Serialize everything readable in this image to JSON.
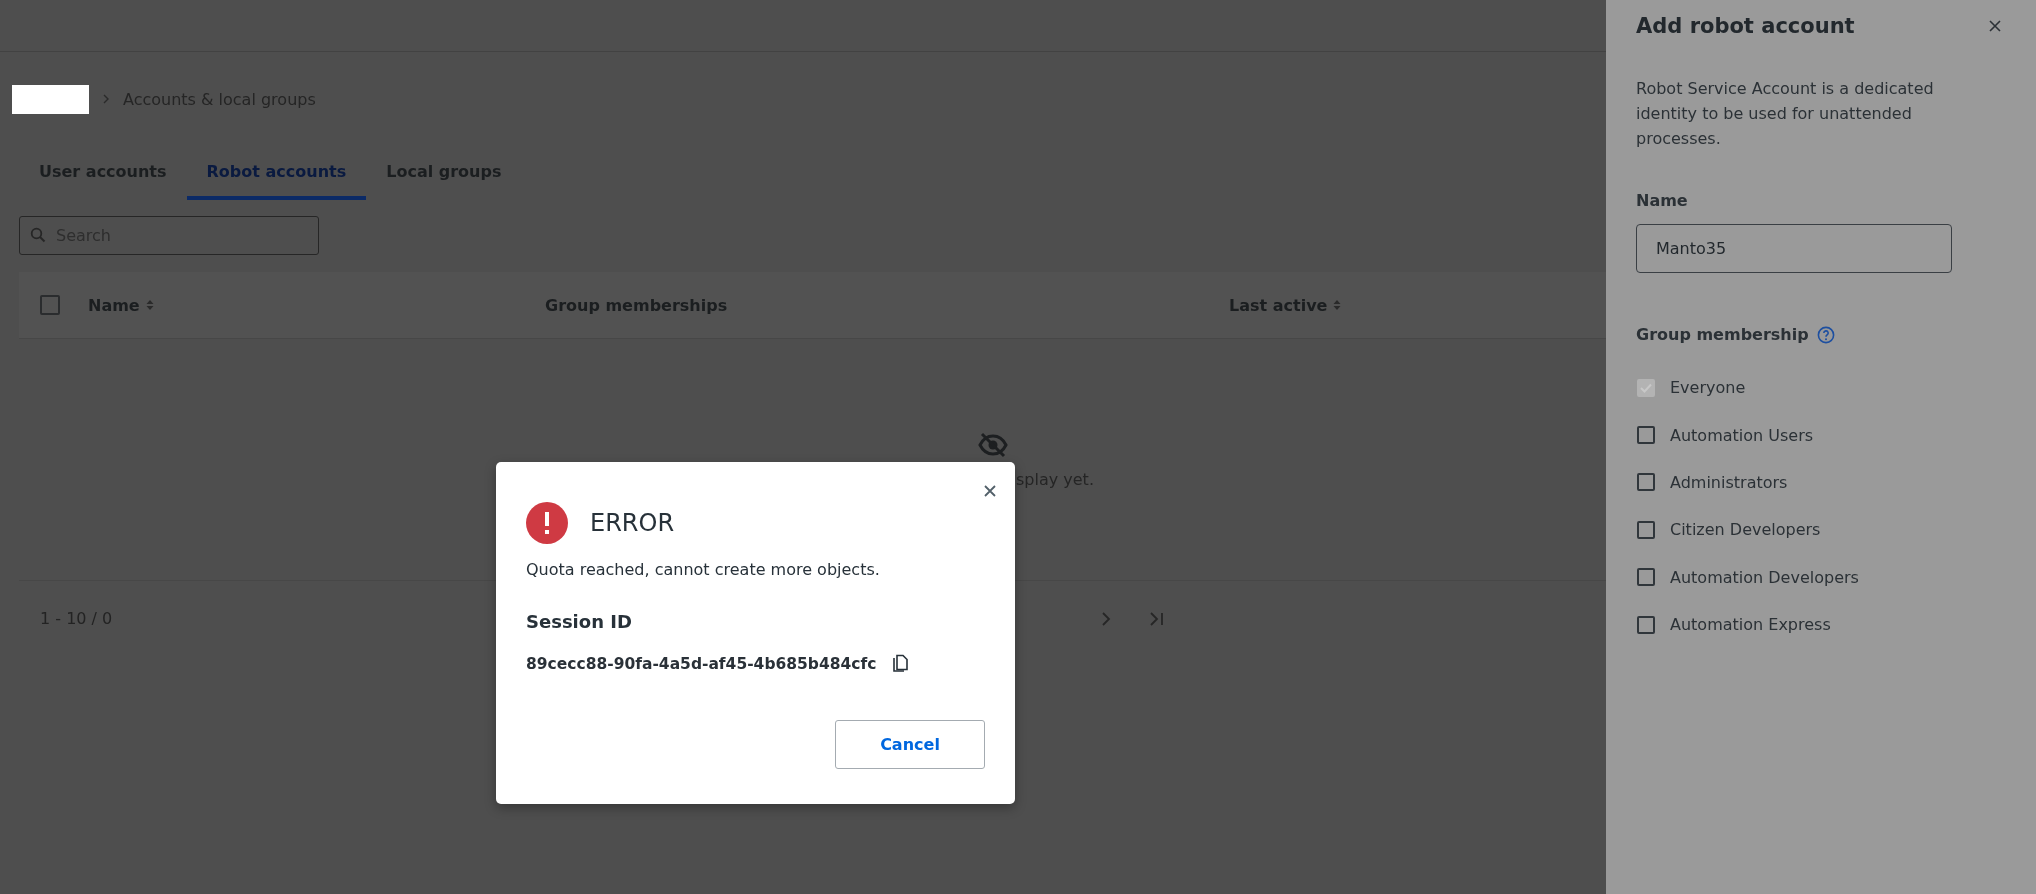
{
  "breadcrumb": {
    "items": [
      {
        "label": "Accounts & local groups"
      }
    ]
  },
  "tabs": [
    {
      "label": "User accounts",
      "selected": false
    },
    {
      "label": "Robot accounts",
      "selected": true
    },
    {
      "label": "Local groups",
      "selected": false
    }
  ],
  "search": {
    "placeholder": "Search"
  },
  "table": {
    "select_all": {
      "checked": false
    },
    "columns": [
      {
        "label": "Name",
        "sortable": true
      },
      {
        "label": "Group memberships",
        "sortable": false
      },
      {
        "label": "Last active",
        "sortable": true
      }
    ],
    "empty_message": "splay yet."
  },
  "pagination": {
    "range": "1 - 10 / 0"
  },
  "panel": {
    "title": "Add robot account",
    "description": "Robot Service Account is a dedicated identity to be used for unattended processes.",
    "name_label": "Name",
    "name_value": "Manto35",
    "group_label": "Group membership",
    "groups": [
      {
        "label": "Everyone",
        "checked": true,
        "disabled": true
      },
      {
        "label": "Automation Users",
        "checked": false,
        "disabled": false
      },
      {
        "label": "Administrators",
        "checked": false,
        "disabled": false
      },
      {
        "label": "Citizen Developers",
        "checked": false,
        "disabled": false
      },
      {
        "label": "Automation Developers",
        "checked": false,
        "disabled": false
      },
      {
        "label": "Automation Express",
        "checked": false,
        "disabled": false
      }
    ]
  },
  "dialog": {
    "title": "ERROR",
    "message": "Quota reached, cannot create more objects.",
    "session_label": "Session ID",
    "session_id": "89cecc88-90fa-4a5d-af45-4b685b484cfc",
    "button": "Cancel"
  }
}
